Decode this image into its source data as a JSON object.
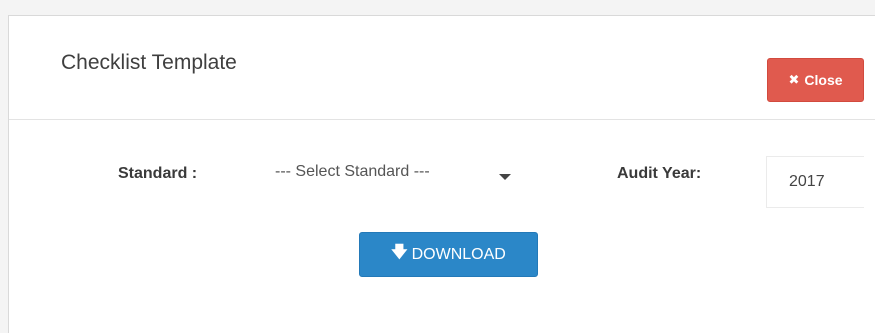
{
  "modal": {
    "title": "Checklist Template",
    "close_icon": "close-icon",
    "close_label": "Close"
  },
  "form": {
    "standard_label": "Standard :",
    "standard_select_value": "--- Select Standard ---",
    "audit_year_label": "Audit Year:",
    "audit_year_value": "2017"
  },
  "actions": {
    "download_icon": "download-icon",
    "download_label": "DOWNLOAD"
  },
  "colors": {
    "close_button": "#e05a4e",
    "download_button": "#2b87c8",
    "background": "#ffffff"
  }
}
